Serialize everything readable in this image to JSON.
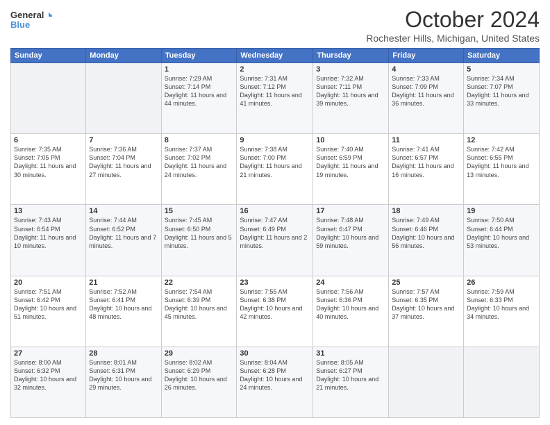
{
  "header": {
    "logo_line1": "General",
    "logo_line2": "Blue",
    "month_title": "October 2024",
    "location": "Rochester Hills, Michigan, United States"
  },
  "weekdays": [
    "Sunday",
    "Monday",
    "Tuesday",
    "Wednesday",
    "Thursday",
    "Friday",
    "Saturday"
  ],
  "weeks": [
    [
      {
        "day": "",
        "sunrise": "",
        "sunset": "",
        "daylight": ""
      },
      {
        "day": "",
        "sunrise": "",
        "sunset": "",
        "daylight": ""
      },
      {
        "day": "1",
        "sunrise": "Sunrise: 7:29 AM",
        "sunset": "Sunset: 7:14 PM",
        "daylight": "Daylight: 11 hours and 44 minutes."
      },
      {
        "day": "2",
        "sunrise": "Sunrise: 7:31 AM",
        "sunset": "Sunset: 7:12 PM",
        "daylight": "Daylight: 11 hours and 41 minutes."
      },
      {
        "day": "3",
        "sunrise": "Sunrise: 7:32 AM",
        "sunset": "Sunset: 7:11 PM",
        "daylight": "Daylight: 11 hours and 39 minutes."
      },
      {
        "day": "4",
        "sunrise": "Sunrise: 7:33 AM",
        "sunset": "Sunset: 7:09 PM",
        "daylight": "Daylight: 11 hours and 36 minutes."
      },
      {
        "day": "5",
        "sunrise": "Sunrise: 7:34 AM",
        "sunset": "Sunset: 7:07 PM",
        "daylight": "Daylight: 11 hours and 33 minutes."
      }
    ],
    [
      {
        "day": "6",
        "sunrise": "Sunrise: 7:35 AM",
        "sunset": "Sunset: 7:05 PM",
        "daylight": "Daylight: 11 hours and 30 minutes."
      },
      {
        "day": "7",
        "sunrise": "Sunrise: 7:36 AM",
        "sunset": "Sunset: 7:04 PM",
        "daylight": "Daylight: 11 hours and 27 minutes."
      },
      {
        "day": "8",
        "sunrise": "Sunrise: 7:37 AM",
        "sunset": "Sunset: 7:02 PM",
        "daylight": "Daylight: 11 hours and 24 minutes."
      },
      {
        "day": "9",
        "sunrise": "Sunrise: 7:38 AM",
        "sunset": "Sunset: 7:00 PM",
        "daylight": "Daylight: 11 hours and 21 minutes."
      },
      {
        "day": "10",
        "sunrise": "Sunrise: 7:40 AM",
        "sunset": "Sunset: 6:59 PM",
        "daylight": "Daylight: 11 hours and 19 minutes."
      },
      {
        "day": "11",
        "sunrise": "Sunrise: 7:41 AM",
        "sunset": "Sunset: 6:57 PM",
        "daylight": "Daylight: 11 hours and 16 minutes."
      },
      {
        "day": "12",
        "sunrise": "Sunrise: 7:42 AM",
        "sunset": "Sunset: 6:55 PM",
        "daylight": "Daylight: 11 hours and 13 minutes."
      }
    ],
    [
      {
        "day": "13",
        "sunrise": "Sunrise: 7:43 AM",
        "sunset": "Sunset: 6:54 PM",
        "daylight": "Daylight: 11 hours and 10 minutes."
      },
      {
        "day": "14",
        "sunrise": "Sunrise: 7:44 AM",
        "sunset": "Sunset: 6:52 PM",
        "daylight": "Daylight: 11 hours and 7 minutes."
      },
      {
        "day": "15",
        "sunrise": "Sunrise: 7:45 AM",
        "sunset": "Sunset: 6:50 PM",
        "daylight": "Daylight: 11 hours and 5 minutes."
      },
      {
        "day": "16",
        "sunrise": "Sunrise: 7:47 AM",
        "sunset": "Sunset: 6:49 PM",
        "daylight": "Daylight: 11 hours and 2 minutes."
      },
      {
        "day": "17",
        "sunrise": "Sunrise: 7:48 AM",
        "sunset": "Sunset: 6:47 PM",
        "daylight": "Daylight: 10 hours and 59 minutes."
      },
      {
        "day": "18",
        "sunrise": "Sunrise: 7:49 AM",
        "sunset": "Sunset: 6:46 PM",
        "daylight": "Daylight: 10 hours and 56 minutes."
      },
      {
        "day": "19",
        "sunrise": "Sunrise: 7:50 AM",
        "sunset": "Sunset: 6:44 PM",
        "daylight": "Daylight: 10 hours and 53 minutes."
      }
    ],
    [
      {
        "day": "20",
        "sunrise": "Sunrise: 7:51 AM",
        "sunset": "Sunset: 6:42 PM",
        "daylight": "Daylight: 10 hours and 51 minutes."
      },
      {
        "day": "21",
        "sunrise": "Sunrise: 7:52 AM",
        "sunset": "Sunset: 6:41 PM",
        "daylight": "Daylight: 10 hours and 48 minutes."
      },
      {
        "day": "22",
        "sunrise": "Sunrise: 7:54 AM",
        "sunset": "Sunset: 6:39 PM",
        "daylight": "Daylight: 10 hours and 45 minutes."
      },
      {
        "day": "23",
        "sunrise": "Sunrise: 7:55 AM",
        "sunset": "Sunset: 6:38 PM",
        "daylight": "Daylight: 10 hours and 42 minutes."
      },
      {
        "day": "24",
        "sunrise": "Sunrise: 7:56 AM",
        "sunset": "Sunset: 6:36 PM",
        "daylight": "Daylight: 10 hours and 40 minutes."
      },
      {
        "day": "25",
        "sunrise": "Sunrise: 7:57 AM",
        "sunset": "Sunset: 6:35 PM",
        "daylight": "Daylight: 10 hours and 37 minutes."
      },
      {
        "day": "26",
        "sunrise": "Sunrise: 7:59 AM",
        "sunset": "Sunset: 6:33 PM",
        "daylight": "Daylight: 10 hours and 34 minutes."
      }
    ],
    [
      {
        "day": "27",
        "sunrise": "Sunrise: 8:00 AM",
        "sunset": "Sunset: 6:32 PM",
        "daylight": "Daylight: 10 hours and 32 minutes."
      },
      {
        "day": "28",
        "sunrise": "Sunrise: 8:01 AM",
        "sunset": "Sunset: 6:31 PM",
        "daylight": "Daylight: 10 hours and 29 minutes."
      },
      {
        "day": "29",
        "sunrise": "Sunrise: 8:02 AM",
        "sunset": "Sunset: 6:29 PM",
        "daylight": "Daylight: 10 hours and 26 minutes."
      },
      {
        "day": "30",
        "sunrise": "Sunrise: 8:04 AM",
        "sunset": "Sunset: 6:28 PM",
        "daylight": "Daylight: 10 hours and 24 minutes."
      },
      {
        "day": "31",
        "sunrise": "Sunrise: 8:05 AM",
        "sunset": "Sunset: 6:27 PM",
        "daylight": "Daylight: 10 hours and 21 minutes."
      },
      {
        "day": "",
        "sunrise": "",
        "sunset": "",
        "daylight": ""
      },
      {
        "day": "",
        "sunrise": "",
        "sunset": "",
        "daylight": ""
      }
    ]
  ]
}
